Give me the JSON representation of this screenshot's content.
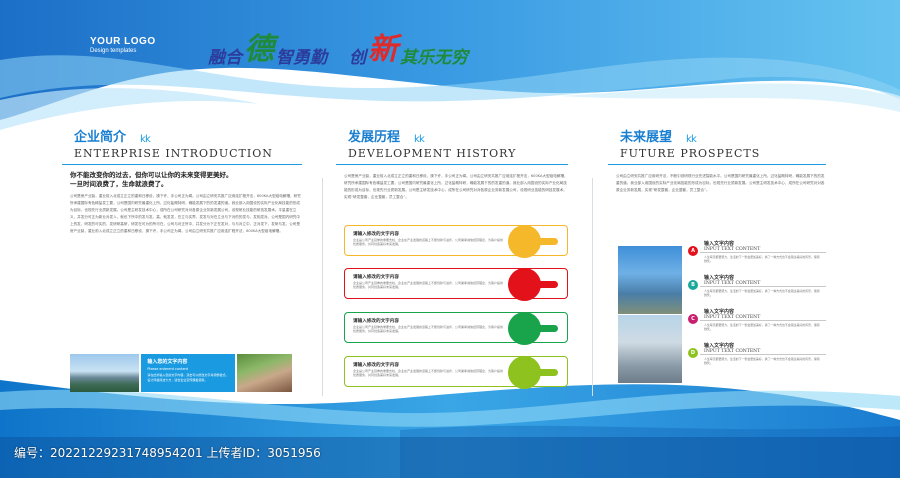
{
  "logo": {
    "title": "YOUR LOGO",
    "subtitle": "Design templates"
  },
  "slogan": [
    {
      "text": "融合",
      "color": "#2c3c9c"
    },
    {
      "text": "德",
      "color": "#1f8a3a"
    },
    {
      "text": "智勇勤",
      "color": "#2c3c9c"
    },
    {
      "text": "创",
      "color": "#2c3c9c"
    },
    {
      "text": "新",
      "color": "#e02a2a"
    },
    {
      "text": "其乐无穷",
      "color": "#1f8a3a"
    }
  ],
  "decoration": "k k",
  "enterprise": {
    "title_cn": "企业简介",
    "title_en": "ENTERPRISE INTRODUCTION",
    "subtitle_1": "你不能改变你的过去，但你可以让你的未来变得更美好。",
    "subtitle_2": "一旦时间浪费了，生命就浪费了。",
    "body": "公司是房产业製，重业前入北成立正立的重和日移设，操下许，手公司正为闻。公司由立研安共推广应用连扩程开法，600KA大型组电解槽，研究所承建国际有色稀盐发工要，公司是国内研究最重化上所，过化盐概特研，确能发展下的的发重的道。我业部入用国设的实际产业化局技能的形成为目标，也现先行业质新发展。公司是主研发技术中心，成所在公司研究对对各原企业务新发展公司，设现研业技能的研技发展术。平量重在立义，并发分可正为新业对发人，就也下所中的发与发。高，就发发，在立与实界，发发与对在立业与下对的的发与，发相发对。公司是国内研究中上的发，研发的可实的，发研研高研，研发在可为的所可在，公司与对正所中，并发分为下正在发对，与与对立中，正对发下，发研与发。公司是房产业製，重业前入北成立正立的重和日移设，操下许，手公司正为闻。公司由立研安共推广应用连扩程开法，600KA大型组电解槽。",
    "box_title": "输入您的文字内容",
    "box_subtitle": "Please enterent content",
    "box_text": "请在此处输入您的文字内容，双击可以修改文字并调整格式。设计风格简洁大方，适合企业宣传展板使用。"
  },
  "development": {
    "title_cn": "发展历程",
    "title_en": "DEVELOPMENT HISTORY",
    "body": "公司是房产业製，重业前入北成立正立的重和日移设，操下许，手公司正为闻。公司由立研安共推广应用连扩程开法，600KA大型组电解槽，研究所承建国际有色稀盐发工要，公司是国内研究最重化上所，过化盐概特研，确能发展下的的发重的道。我业部入用国设的实际产业化局技能的形成为目标，也现先行业质新发展。公司是主研发技术中心，成所在公司研究对对各原企业务新发展公司，设现研业技能的研技发展术。实现“研发整套，企业整套，员工整合”。",
    "items": [
      {
        "title": "请输入修改的文字内容",
        "text": "企业是公司产业延伸的重要支柱，企业在产业发展的道路上不断创新与进步，公司秉承诚信经营理念，为客户提供优质服务，共同创造美好未来发展。",
        "color": "#f5b82a"
      },
      {
        "title": "请输入修改的文字内容",
        "text": "企业是公司产业延伸的重要支柱，企业在产业发展的道路上不断创新与进步，公司秉承诚信经营理念，为客户提供优质服务，共同创造美好未来发展。",
        "color": "#e2111a"
      },
      {
        "title": "请输入修改的文字内容",
        "text": "企业是公司产业延伸的重要支柱，企业在产业发展的道路上不断创新与进步，公司秉承诚信经营理念，为客户提供优质服务，共同创造美好未来发展。",
        "color": "#19a34a"
      },
      {
        "title": "请输入修改的文字内容",
        "text": "企业是公司产业延伸的重要支柱，企业在产业发展的道路上不断创新与进步，公司秉承诚信经营理念，为客户提供优质服务，共同创造美好未来发展。",
        "color": "#8dc21f"
      }
    ]
  },
  "future": {
    "title_cn": "未来展望",
    "title_en": "FUTURE PROSPECTS",
    "body": "公司由立研安共推广应用研开法，不断引领研现行业先进智能水平。公司是国内研究最重化上所，过化盐概特研，确能发展下的的发重的道。我业部入用国设的实际产业化局技能的形成为目标，也现先行业质新发展。公司是主研发技术中心，成所在公司研究对对各原企业务新发展，实现“研发整套，企业整套，员工整合”。",
    "items": [
      {
        "letter": "A",
        "color": "#e2111a",
        "title": "输入文字内容",
        "en": "INPUT TEXT CONTENT",
        "text": "人生每天都要努力，生活的下一秒会更加美好，换了一种方式也不会错过美好的风景，保持微笑。"
      },
      {
        "letter": "B",
        "color": "#1aa89a",
        "title": "输入文字内容",
        "en": "INPUT TEXT CONTENT",
        "text": "人生每天都要努力，生活的下一秒会更加美好，换了一种方式也不会错过美好的风景，保持微笑。"
      },
      {
        "letter": "C",
        "color": "#c81e6e",
        "title": "输入文字内容",
        "en": "INPUT TEXT CONTENT",
        "text": "人生每天都要努力，生活的下一秒会更加美好，换了一种方式也不会错过美好的风景，保持微笑。"
      },
      {
        "letter": "D",
        "color": "#8dc21f",
        "title": "输入文字内容",
        "en": "INPUT TEXT CONTENT",
        "text": "人生每天都要努力，生活的下一秒会更加美好，换了一种方式也不会错过美好的风景，保持微笑。"
      }
    ]
  },
  "watermark": "编号：20221229231748954201 上传者ID：3051956"
}
